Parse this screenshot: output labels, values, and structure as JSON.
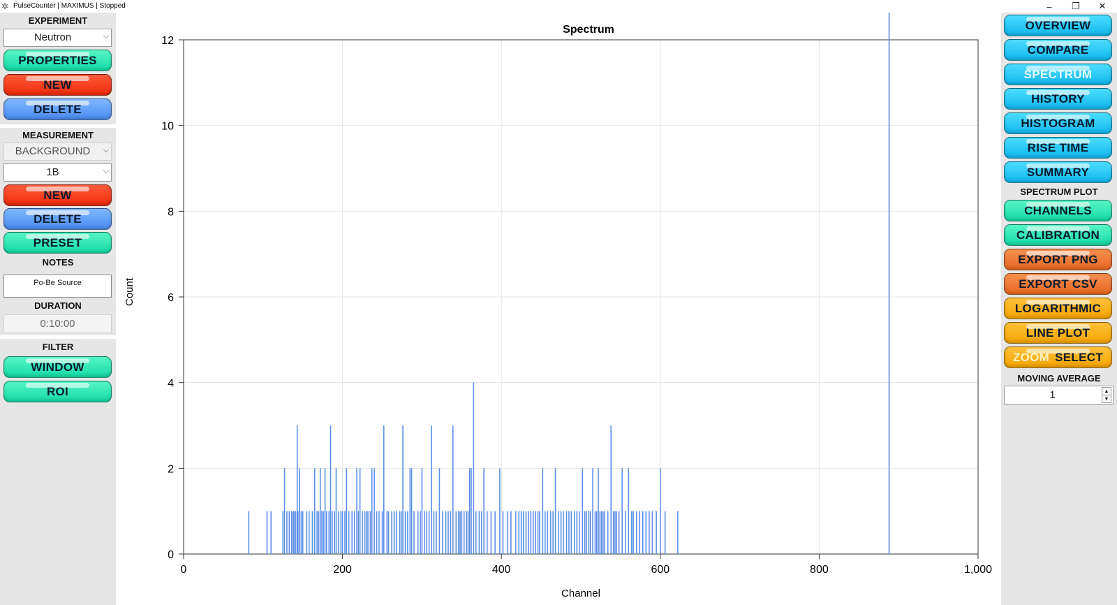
{
  "window": {
    "title": "PulseCounter | MAXIMUS | Stopped"
  },
  "left": {
    "experiment_label": "EXPERIMENT",
    "experiment_value": "Neutron",
    "properties": "PROPERTIES",
    "new1": "NEW",
    "delete1": "DELETE",
    "measurement_label": "MEASUREMENT",
    "measurement_type": "BACKGROUND",
    "measurement_value": "1B",
    "new2": "NEW",
    "delete2": "DELETE",
    "preset": "PRESET",
    "notes_label": "NOTES",
    "notes_value": "Po-Be Source",
    "duration_label": "DURATION",
    "duration_value": "0:10:00",
    "filter_label": "FILTER",
    "window_btn": "WINDOW",
    "roi_btn": "ROI"
  },
  "right": {
    "overview": "OVERVIEW",
    "compare": "COMPARE",
    "spectrum": "SPECTRUM",
    "history": "HISTORY",
    "histogram": "HISTOGRAM",
    "rise_time": "RISE TIME",
    "summary": "SUMMARY",
    "spectrum_plot_label": "SPECTRUM PLOT",
    "channels": "CHANNELS",
    "calibration": "CALIBRATION",
    "export_png": "EXPORT PNG",
    "export_csv": "EXPORT CSV",
    "logarithmic": "LOGARITHMIC",
    "line_plot": "LINE PLOT",
    "zoom": "ZOOM",
    "select": "SELECT",
    "moving_average_label": "MOVING AVERAGE",
    "moving_average_value": "1"
  },
  "chart_data": {
    "type": "bar",
    "title": "Spectrum",
    "xlabel": "Channel",
    "ylabel": "Count",
    "xlim": [
      0,
      1000
    ],
    "ylim": [
      0,
      12
    ],
    "x_ticks": [
      "0",
      "200",
      "400",
      "600",
      "800",
      "1,000"
    ],
    "y_ticks": [
      "0",
      "2",
      "4",
      "6",
      "8",
      "10",
      "12"
    ],
    "grid": true,
    "color": "#5b8fe8",
    "x": [
      82,
      105,
      110,
      125,
      127,
      130,
      133,
      136,
      138,
      139,
      141,
      143,
      144,
      146,
      148,
      150,
      155,
      158,
      162,
      165,
      168,
      170,
      172,
      174,
      176,
      178,
      180,
      183,
      185,
      187,
      190,
      192,
      195,
      198,
      200,
      203,
      205,
      208,
      212,
      215,
      218,
      220,
      222,
      225,
      228,
      230,
      232,
      235,
      237,
      240,
      243,
      246,
      250,
      252,
      256,
      258,
      262,
      265,
      268,
      272,
      274,
      276,
      279,
      282,
      285,
      287,
      290,
      295,
      298,
      300,
      303,
      306,
      309,
      312,
      315,
      318,
      322,
      326,
      330,
      333,
      336,
      339,
      343,
      346,
      348,
      350,
      353,
      356,
      358,
      360,
      362,
      365,
      368,
      372,
      375,
      378,
      382,
      387,
      392,
      398,
      402,
      408,
      412,
      418,
      422,
      425,
      428,
      431,
      434,
      437,
      440,
      443,
      446,
      448,
      452,
      455,
      458,
      462,
      465,
      468,
      472,
      475,
      478,
      482,
      485,
      488,
      492,
      495,
      498,
      502,
      505,
      507,
      510,
      512,
      515,
      518,
      520,
      522,
      524,
      526,
      528,
      530,
      534,
      538,
      541,
      543,
      545,
      548,
      552,
      556,
      560,
      564,
      566,
      570,
      574,
      578,
      582,
      586,
      590,
      595,
      600,
      606,
      622,
      888
    ],
    "values": [
      1,
      1,
      1,
      1,
      2,
      1,
      1,
      1,
      1,
      1,
      1,
      3,
      1,
      2,
      1,
      1,
      1,
      1,
      1,
      2,
      1,
      1,
      2,
      1,
      1,
      2,
      1,
      1,
      3,
      1,
      1,
      2,
      1,
      1,
      1,
      1,
      2,
      1,
      1,
      1,
      2,
      1,
      2,
      1,
      1,
      1,
      1,
      1,
      2,
      2,
      1,
      1,
      1,
      3,
      1,
      1,
      1,
      1,
      1,
      1,
      1,
      3,
      1,
      1,
      2,
      2,
      1,
      1,
      1,
      2,
      1,
      1,
      1,
      3,
      1,
      1,
      2,
      1,
      1,
      1,
      1,
      3,
      1,
      1,
      1,
      1,
      1,
      1,
      1,
      2,
      2,
      4,
      1,
      1,
      1,
      2,
      1,
      1,
      1,
      2,
      1,
      1,
      1,
      1,
      1,
      1,
      1,
      1,
      1,
      1,
      1,
      1,
      1,
      1,
      2,
      1,
      1,
      1,
      1,
      2,
      1,
      1,
      1,
      1,
      1,
      1,
      1,
      1,
      1,
      2,
      1,
      1,
      1,
      1,
      2,
      1,
      1,
      2,
      1,
      1,
      1,
      1,
      1,
      3,
      1,
      1,
      1,
      1,
      2,
      1,
      2,
      1,
      1,
      1,
      1,
      1,
      1,
      1,
      1,
      1,
      2,
      1,
      1
    ]
  }
}
